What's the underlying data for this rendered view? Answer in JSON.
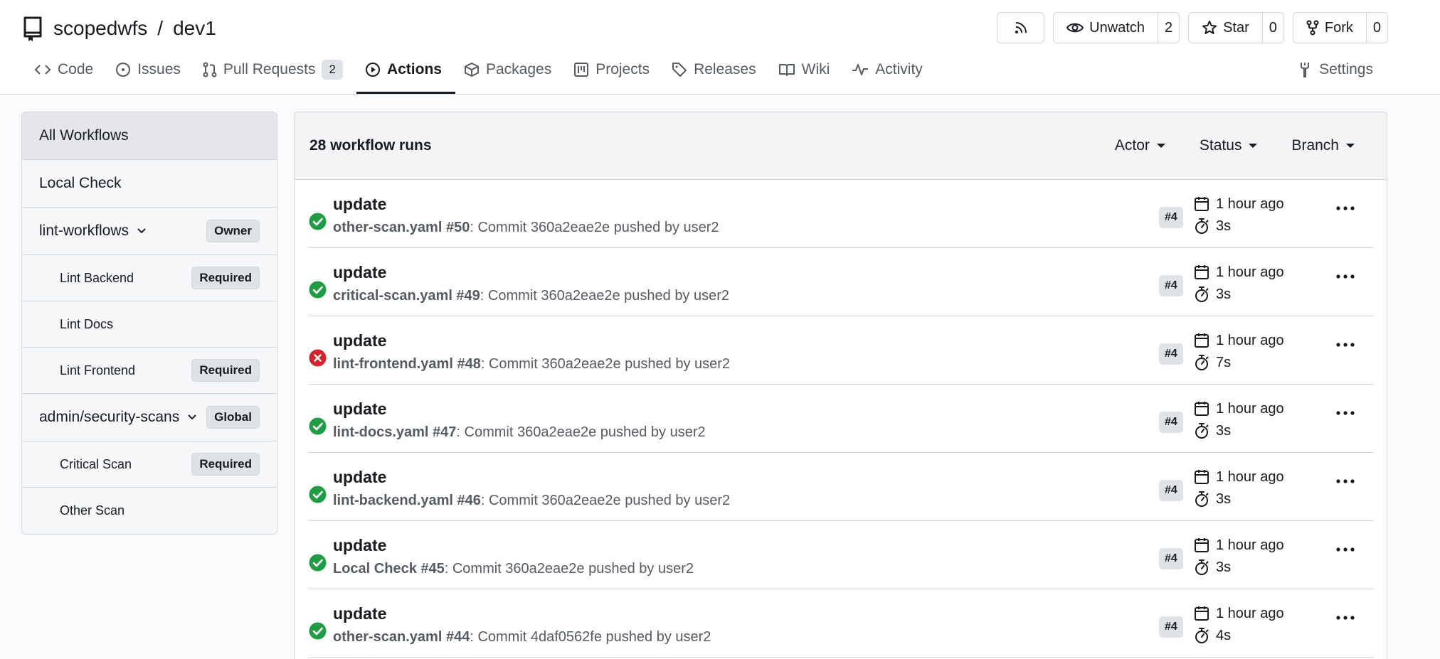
{
  "repo": {
    "owner": "scopedwfs",
    "separator": "/",
    "name": "dev1"
  },
  "header_buttons": {
    "rss_icon": "rss-icon",
    "unwatch_label": "Unwatch",
    "unwatch_count": "2",
    "star_label": "Star",
    "star_count": "0",
    "fork_label": "Fork",
    "fork_count": "0"
  },
  "tabs": [
    {
      "label": "Code",
      "icon": "code-icon"
    },
    {
      "label": "Issues",
      "icon": "issue-icon"
    },
    {
      "label": "Pull Requests",
      "icon": "pull-request-icon",
      "badge": "2"
    },
    {
      "label": "Actions",
      "icon": "play-icon",
      "active": true
    },
    {
      "label": "Packages",
      "icon": "package-icon"
    },
    {
      "label": "Projects",
      "icon": "project-icon"
    },
    {
      "label": "Releases",
      "icon": "tag-icon"
    },
    {
      "label": "Wiki",
      "icon": "book-icon"
    },
    {
      "label": "Activity",
      "icon": "pulse-icon"
    }
  ],
  "settings_label": "Settings",
  "sidebar": {
    "all_workflows": "All Workflows",
    "local_check": "Local Check",
    "lint_group": {
      "label": "lint-workflows",
      "badge": "Owner"
    },
    "lint_items": [
      {
        "label": "Lint Backend",
        "badge": "Required"
      },
      {
        "label": "Lint Docs",
        "badge": ""
      },
      {
        "label": "Lint Frontend",
        "badge": "Required"
      }
    ],
    "security_group": {
      "label": "admin/security-scans",
      "badge": "Global"
    },
    "security_items": [
      {
        "label": "Critical Scan",
        "badge": "Required"
      },
      {
        "label": "Other Scan",
        "badge": ""
      }
    ]
  },
  "runs_header": {
    "count_label": "28 workflow runs",
    "actor": "Actor",
    "status": "Status",
    "branch": "Branch"
  },
  "runs": [
    {
      "status": "success",
      "title": "update",
      "workflow": "other-scan.yaml #50",
      "detail": ": Commit 360a2eae2e pushed by user2",
      "ref": "#4",
      "when": "1 hour ago",
      "duration": "3s"
    },
    {
      "status": "success",
      "title": "update",
      "workflow": "critical-scan.yaml #49",
      "detail": ": Commit 360a2eae2e pushed by user2",
      "ref": "#4",
      "when": "1 hour ago",
      "duration": "3s"
    },
    {
      "status": "failure",
      "title": "update",
      "workflow": "lint-frontend.yaml #48",
      "detail": ": Commit 360a2eae2e pushed by user2",
      "ref": "#4",
      "when": "1 hour ago",
      "duration": "7s"
    },
    {
      "status": "success",
      "title": "update",
      "workflow": "lint-docs.yaml #47",
      "detail": ": Commit 360a2eae2e pushed by user2",
      "ref": "#4",
      "when": "1 hour ago",
      "duration": "3s"
    },
    {
      "status": "success",
      "title": "update",
      "workflow": "lint-backend.yaml #46",
      "detail": ": Commit 360a2eae2e pushed by user2",
      "ref": "#4",
      "when": "1 hour ago",
      "duration": "3s"
    },
    {
      "status": "success",
      "title": "update",
      "workflow": "Local Check #45",
      "detail": ": Commit 360a2eae2e pushed by user2",
      "ref": "#4",
      "when": "1 hour ago",
      "duration": "3s"
    },
    {
      "status": "success",
      "title": "update",
      "workflow": "other-scan.yaml #44",
      "detail": ": Commit 4daf0562fe pushed by user2",
      "ref": "#4",
      "when": "1 hour ago",
      "duration": "4s"
    }
  ],
  "colors": {
    "success": "#1f9d45",
    "failure": "#d1242f",
    "border": "#d0d7de"
  }
}
